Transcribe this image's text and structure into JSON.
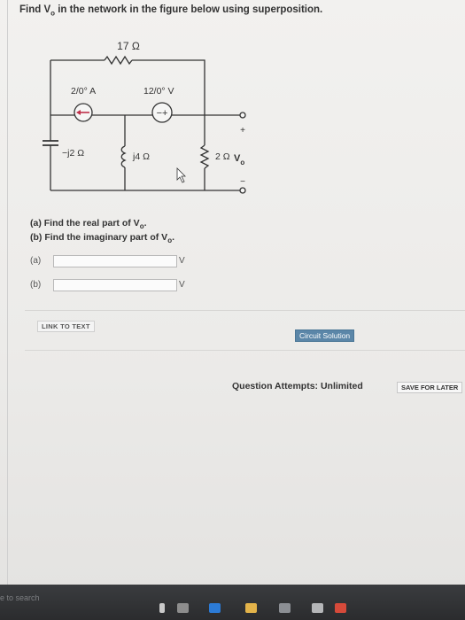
{
  "question": {
    "prefix": "Find V",
    "sub": "o",
    "suffix": " in the network in the figure below using superposition."
  },
  "circuit": {
    "r_top": "17 Ω",
    "current_source": "2/0° A",
    "voltage_source": "12/0° V",
    "capacitor": "−j2 Ω",
    "inductor": "j4 Ω",
    "r_right": "2 Ω",
    "vo_label": "V",
    "vo_sub": "o",
    "plus": "+",
    "minus": "−"
  },
  "parts": {
    "a_prefix": "(a) Find the real part of V",
    "a_sub": "o",
    "a_suffix": ".",
    "b_prefix": "(b) Find the imaginary part of V",
    "b_sub": "o",
    "b_suffix": "."
  },
  "answers": [
    {
      "label": "(a)",
      "value": "",
      "unit": "V"
    },
    {
      "label": "(b)",
      "value": "",
      "unit": "V"
    }
  ],
  "link_to_text": "LINK TO TEXT",
  "circuit_solution": "Circuit Solution",
  "attempts": "Question Attempts: Unlimited",
  "save_for_later": "SAVE FOR LATER",
  "taskbar": {
    "search": "e to search"
  },
  "colors": {
    "accent": "#5b86a8",
    "arrow": "#c0304a"
  }
}
